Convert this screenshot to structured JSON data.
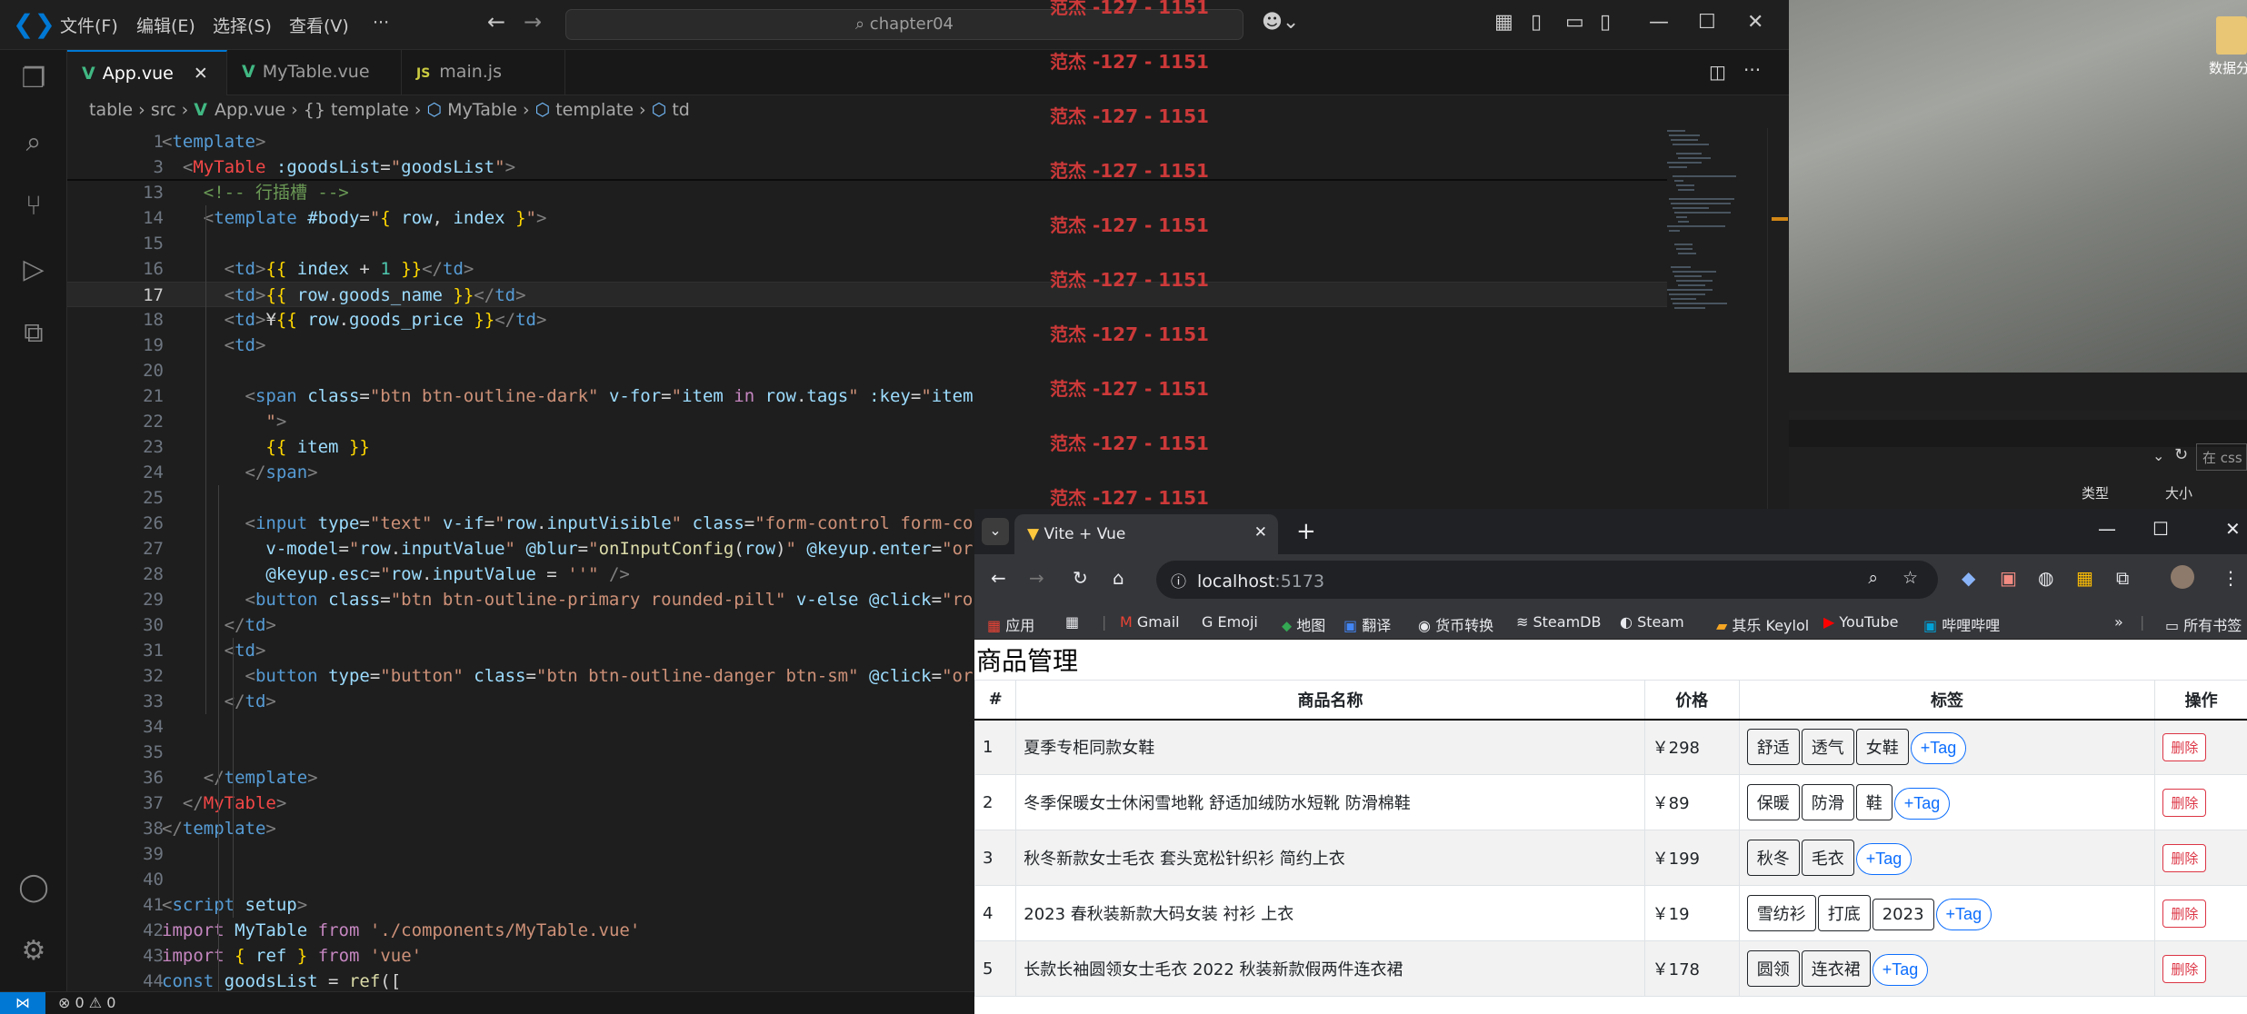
{
  "vscode": {
    "menu": [
      "文件(F)",
      "编辑(E)",
      "选择(S)",
      "查看(V)",
      "···"
    ],
    "search": "chapter04",
    "tabs": [
      {
        "label": "App.vue",
        "icon": "vue",
        "active": true
      },
      {
        "label": "MyTable.vue",
        "icon": "vue",
        "active": false
      },
      {
        "label": "main.js",
        "icon": "js",
        "active": false
      }
    ],
    "breadcrumb": [
      "table",
      "src",
      "App.vue",
      "{} template",
      "MyTable",
      "template",
      "td"
    ],
    "status": {
      "remote": "⋈",
      "problems": "⊗ 0 ⚠ 0"
    },
    "lines": [
      {
        "n": "1",
        "html": "<span class='g'>&lt;</span><span class='t'>template</span><span class='g'>&gt;</span>"
      },
      {
        "n": "3",
        "html": "  <span class='g'>&lt;</span><span class='rd'>MyTable</span> <span class='a'>:goodsList</span>=<span class='s'>\"</span><span class='a'>goodsList</span><span class='s'>\"</span><span class='g'>&gt;</span>"
      },
      {
        "n": "13",
        "html": "    <span class='cm'>&lt;!-- 行插槽 --&gt;</span>"
      },
      {
        "n": "14",
        "html": "    <span class='g'>&lt;</span><span class='t'>template</span> <span class='a'>#body</span>=<span class='s'>\"</span><span class='br'>{</span> <span class='a'>row</span>, <span class='a'>index</span> <span class='br'>}</span><span class='s'>\"</span><span class='g'>&gt;</span>"
      },
      {
        "n": "15",
        "html": ""
      },
      {
        "n": "16",
        "html": "      <span class='g'>&lt;</span><span class='t'>td</span><span class='g'>&gt;</span><span class='br'>{{</span> <span class='a'>index</span> + <span class='cy'>1</span> <span class='br'>}}</span><span class='g'>&lt;/</span><span class='t'>td</span><span class='g'>&gt;</span>"
      },
      {
        "n": "17",
        "html": "      <span class='g'>&lt;</span><span class='t'>td</span><span class='g'>&gt;</span><span class='br'>{{</span> <span class='a'>row</span>.<span class='a'>goods_name</span> <span class='br'>}}</span><span class='g'>&lt;/</span><span class='t'>td</span><span class='g'>&gt;</span>",
        "cur": true
      },
      {
        "n": "18",
        "html": "      <span class='g'>&lt;</span><span class='t'>td</span><span class='g'>&gt;</span>¥<span class='br'>{{</span> <span class='a'>row</span>.<span class='a'>goods_price</span> <span class='br'>}}</span><span class='g'>&lt;/</span><span class='t'>td</span><span class='g'>&gt;</span>"
      },
      {
        "n": "19",
        "html": "      <span class='g'>&lt;</span><span class='t'>td</span><span class='g'>&gt;</span>"
      },
      {
        "n": "20",
        "html": ""
      },
      {
        "n": "21",
        "html": "        <span class='g'>&lt;</span><span class='t'>span</span> <span class='a'>class</span>=<span class='s'>\"btn btn-outline-dark\"</span> <span class='a'>v-for</span>=<span class='s'>\"</span><span class='a'>item</span> <span class='k'>in</span> <span class='a'>row</span>.<span class='a'>tags</span><span class='s'>\"</span> <span class='a'>:key</span>=<span class='s'>\"</span><span class='a'>item</span>"
      },
      {
        "n": "22",
        "html": "          <span class='s'>\"</span><span class='g'>&gt;</span>"
      },
      {
        "n": "23",
        "html": "          <span class='br'>{{</span> <span class='a'>item</span> <span class='br'>}}</span>"
      },
      {
        "n": "24",
        "html": "        <span class='g'>&lt;/</span><span class='t'>span</span><span class='g'>&gt;</span>"
      },
      {
        "n": "25",
        "html": ""
      },
      {
        "n": "26",
        "html": "        <span class='g'>&lt;</span><span class='t'>input</span> <span class='a'>type</span>=<span class='s'>\"text\"</span> <span class='a'>v-if</span>=<span class='s'>\"</span><span class='a'>row</span>.<span class='a'>inputVisible</span><span class='s'>\"</span> <span class='a'>class</span>=<span class='s'>\"form-control form-co</span>"
      },
      {
        "n": "27",
        "html": "          <span class='a'>v-model</span>=<span class='s'>\"</span><span class='a'>row</span>.<span class='a'>inputValue</span><span class='s'>\"</span> <span class='a'>@blur</span>=<span class='s'>\"</span><span class='y'>onInputConfig</span>(<span class='a'>row</span>)<span class='s'>\"</span> <span class='a'>@keyup.enter</span>=<span class='s'>\"or</span>"
      },
      {
        "n": "28",
        "html": "          <span class='a'>@keyup.esc</span>=<span class='s'>\"</span><span class='a'>row</span>.<span class='a'>inputValue</span> = <span class='s'>''\"</span> <span class='g'>/&gt;</span>"
      },
      {
        "n": "29",
        "html": "        <span class='g'>&lt;</span><span class='t'>button</span> <span class='a'>class</span>=<span class='s'>\"btn btn-outline-primary rounded-pill\"</span> <span class='a'>v-else</span> <span class='a'>@click</span>=<span class='s'>\"ro</span>"
      },
      {
        "n": "30",
        "html": "      <span class='g'>&lt;/</span><span class='t'>td</span><span class='g'>&gt;</span>"
      },
      {
        "n": "31",
        "html": "      <span class='g'>&lt;</span><span class='t'>td</span><span class='g'>&gt;</span>"
      },
      {
        "n": "32",
        "html": "        <span class='g'>&lt;</span><span class='t'>button</span> <span class='a'>type</span>=<span class='s'>\"button\"</span> <span class='a'>class</span>=<span class='s'>\"btn btn-outline-danger btn-sm\"</span> <span class='a'>@click</span>=<span class='s'>\"or</span>"
      },
      {
        "n": "33",
        "html": "      <span class='g'>&lt;/</span><span class='t'>td</span><span class='g'>&gt;</span>"
      },
      {
        "n": "34",
        "html": ""
      },
      {
        "n": "35",
        "html": ""
      },
      {
        "n": "36",
        "html": "    <span class='g'>&lt;/</span><span class='t'>template</span><span class='g'>&gt;</span>"
      },
      {
        "n": "37",
        "html": "  <span class='g'>&lt;/</span><span class='rd'>MyTable</span><span class='g'>&gt;</span>"
      },
      {
        "n": "38",
        "html": "<span class='g'>&lt;/</span><span class='t'>template</span><span class='g'>&gt;</span>"
      },
      {
        "n": "39",
        "html": ""
      },
      {
        "n": "40",
        "html": ""
      },
      {
        "n": "41",
        "html": "<span class='g'>&lt;</span><span class='t'>script</span> <span class='a'>setup</span><span class='g'>&gt;</span>"
      },
      {
        "n": "42",
        "html": "<span class='k'>import</span> <span class='a'>MyTable</span> <span class='k'>from</span> <span class='s'>'./components/MyTable.vue'</span>"
      },
      {
        "n": "43",
        "html": "<span class='k'>import</span> <span class='br'>{</span> <span class='a'>ref</span> <span class='br'>}</span> <span class='k'>from</span> <span class='s'>'vue'</span>"
      },
      {
        "n": "44",
        "html": "<span class='t'>const</span> <span class='a'>goodsList</span> = <span class='y'>ref</span>(["
      }
    ]
  },
  "watermark": "范杰 -127 - 1151",
  "desktop": {
    "file_label": "数据分"
  },
  "explorer": {
    "search_placeholder": "在 css",
    "col_type": "类型",
    "col_size": "大小"
  },
  "chrome": {
    "tab_title": "Vite + Vue",
    "url_host": "localhost",
    "url_port": ":5173",
    "bookmarks": [
      "应用",
      "",
      "Gmail",
      "Emoji",
      "地图",
      "翻译",
      "货币转换",
      "SteamDB",
      "Steam",
      "其乐 Keylol",
      "YouTube",
      "哔哩哔哩"
    ],
    "bookmarks_more": "»",
    "all_bookmarks": "所有书签",
    "page": {
      "title": "商品管理",
      "headers": [
        "#",
        "商品名称",
        "价格",
        "标签",
        "操作"
      ],
      "add_tag": "+Tag",
      "delete": "删除",
      "rows": [
        {
          "idx": "1",
          "name": "夏季专柜同款女鞋",
          "price": "￥298",
          "tags": [
            "舒适",
            "透气",
            "女鞋"
          ]
        },
        {
          "idx": "2",
          "name": "冬季保暖女士休闲雪地靴 舒适加绒防水短靴 防滑棉鞋",
          "price": "￥89",
          "tags": [
            "保暖",
            "防滑",
            "鞋"
          ]
        },
        {
          "idx": "3",
          "name": "秋冬新款女士毛衣 套头宽松针织衫 简约上衣",
          "price": "￥199",
          "tags": [
            "秋冬",
            "毛衣"
          ]
        },
        {
          "idx": "4",
          "name": "2023 春秋装新款大码女装 衬衫 上衣",
          "price": "￥19",
          "tags": [
            "雪纺衫",
            "打底",
            "2023"
          ]
        },
        {
          "idx": "5",
          "name": "长款长袖圆领女士毛衣 2022 秋装新款假两件连衣裙",
          "price": "￥178",
          "tags": [
            "圆领",
            "连衣裙"
          ]
        }
      ]
    }
  }
}
